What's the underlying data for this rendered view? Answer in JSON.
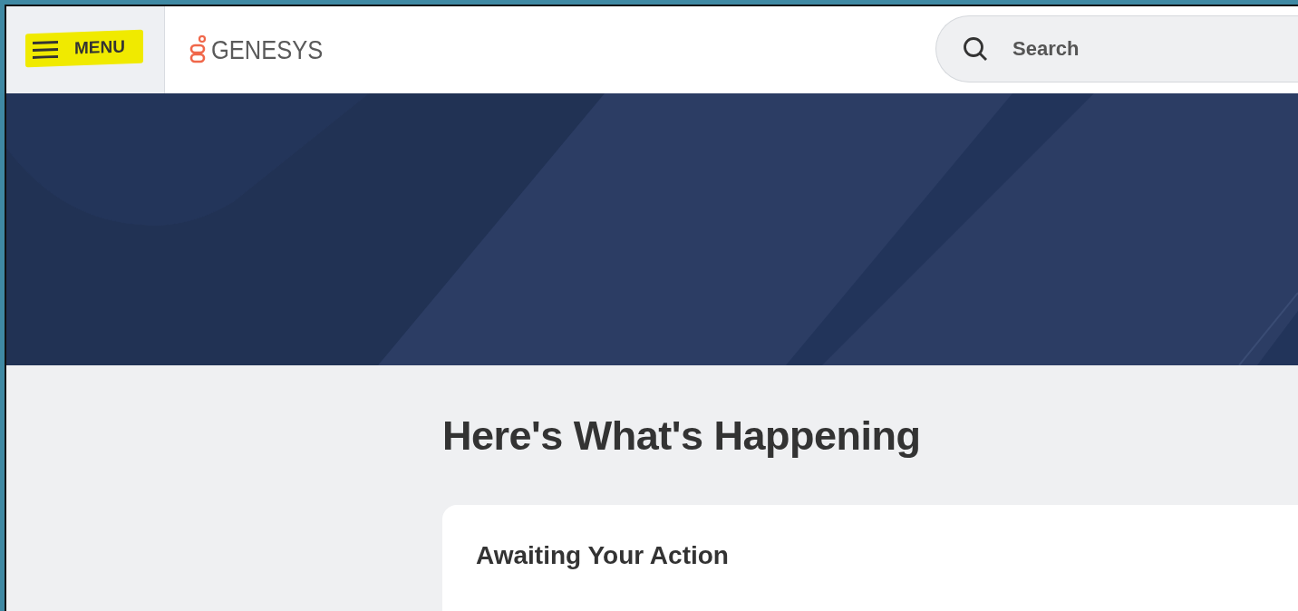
{
  "header": {
    "menu_label": "MENU",
    "logo_text": "GENESYS",
    "search": {
      "placeholder": "Search"
    }
  },
  "banner": {
    "kind": "decoration"
  },
  "main": {
    "heading": "Here's What's Happening",
    "card": {
      "title": "Awaiting Your Action"
    }
  }
}
